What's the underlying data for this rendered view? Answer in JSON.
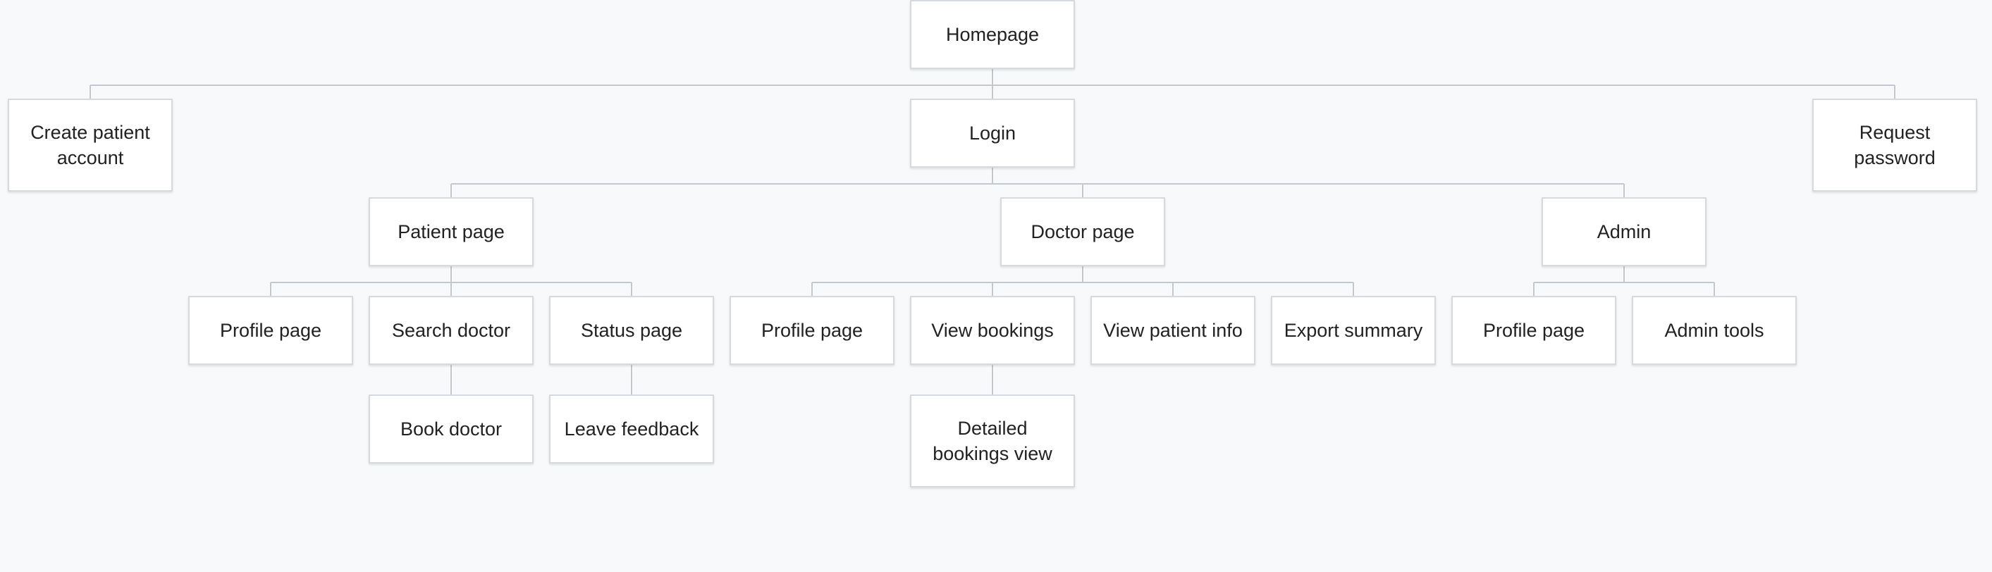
{
  "colors": {
    "background": "#f8f9fa",
    "node_fill": "#ffffff",
    "node_border": "#d6d9dd",
    "connector": "#c4c8cd",
    "text": "#222222"
  },
  "nodes": {
    "homepage": "Homepage",
    "create_patient_account": "Create patient account",
    "login": "Login",
    "request_password": "Request password",
    "patient_page": "Patient page",
    "doctor_page": "Doctor page",
    "admin": "Admin",
    "patient_profile_page": "Profile page",
    "search_doctor": "Search doctor",
    "status_page": "Status page",
    "doctor_profile_page": "Profile page",
    "view_bookings": "View bookings",
    "view_patient_info": "View patient info",
    "export_summary": "Export summary",
    "admin_profile_page": "Profile page",
    "admin_tools": "Admin tools",
    "book_doctor": "Book doctor",
    "leave_feedback": "Leave feedback",
    "detailed_bookings_view": "Detailed bookings view"
  }
}
